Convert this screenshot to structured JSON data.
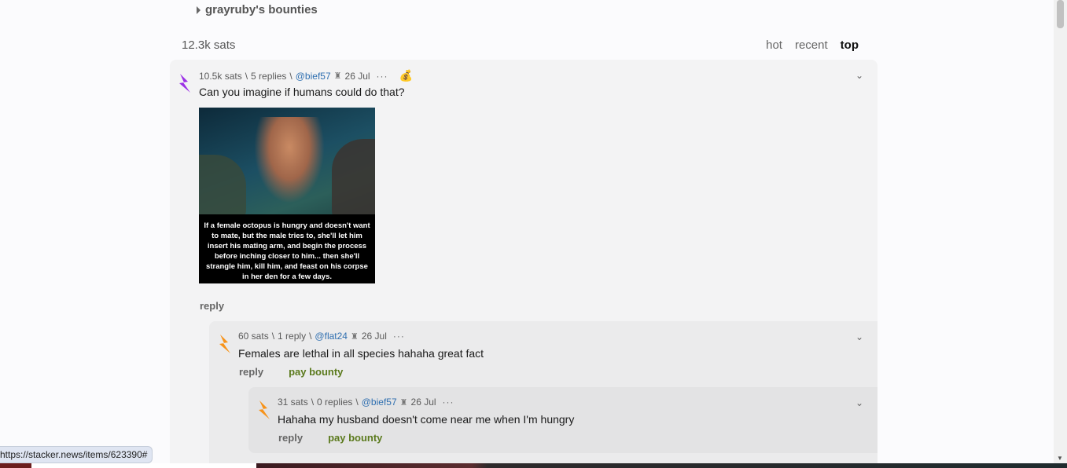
{
  "bounties": {
    "label": "grayruby's bounties"
  },
  "header": {
    "total_sats": "12.3k sats",
    "sort": [
      "hot",
      "recent",
      "top"
    ],
    "active_sort": "top"
  },
  "comments": [
    {
      "sats": "10.5k sats",
      "replies": "5 replies",
      "user": "@bief57",
      "date": "26 Jul",
      "text": "Can you imagine if humans could do that?",
      "image_caption": "If a female octopus is hungry and doesn't want to mate, but the male tries to, she'll let him insert his mating arm, and begin the process before inching closer to him... then she'll strangle him, kill him, and feast on his corpse in her den for a few days.",
      "reply_label": "reply"
    },
    {
      "sats": "60 sats",
      "replies": "1 reply",
      "user": "@flat24",
      "date": "26 Jul",
      "text": "Females are lethal in all species hahaha great fact",
      "reply_label": "reply",
      "bounty_label": "pay bounty"
    },
    {
      "sats": "31 sats",
      "replies": "0 replies",
      "user": "@bief57",
      "date": "26 Jul",
      "text": "Hahaha my husband doesn't come near me when I'm hungry",
      "reply_label": "reply",
      "bounty_label": "pay bounty"
    }
  ],
  "status": {
    "url": "https://stacker.news/items/623390#"
  },
  "colors": {
    "bolt_purple": "#9b30e6",
    "bolt_orange": "#f7931a",
    "user_link": "#2f6fb0",
    "bounty": "#5b7a1d"
  }
}
